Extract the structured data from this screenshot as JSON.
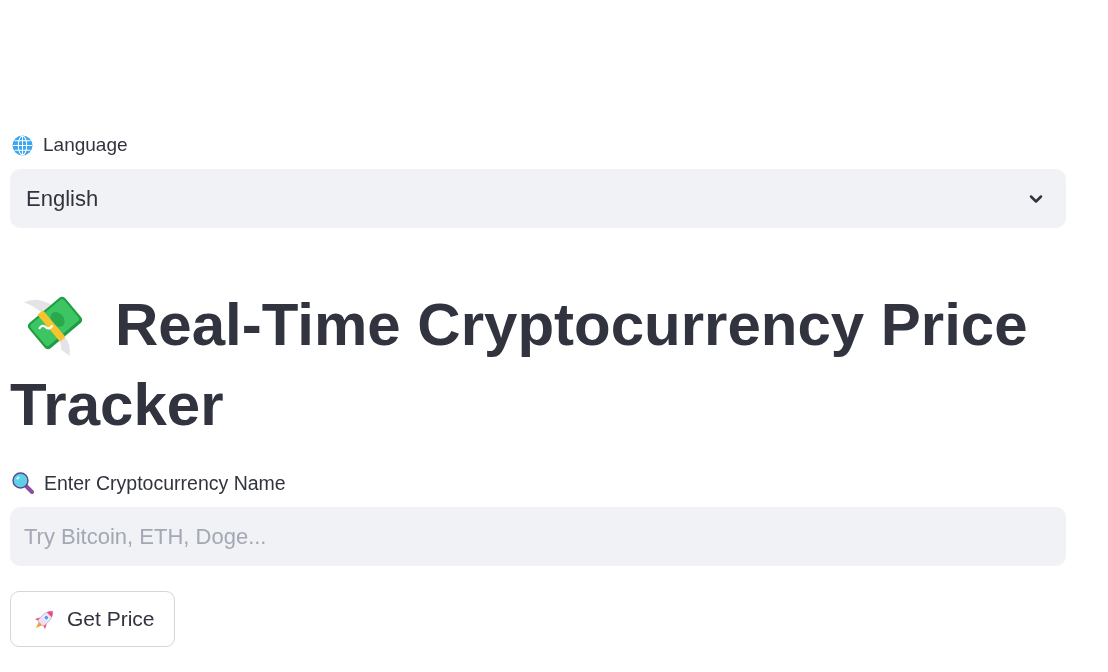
{
  "language": {
    "label": "Language",
    "value": "English"
  },
  "title": "Real-Time Cryptocurrency Price Tracker",
  "search": {
    "label": "Enter Cryptocurrency Name",
    "placeholder": "Try Bitcoin, ETH, Doge..."
  },
  "button": {
    "label": "Get Price"
  }
}
